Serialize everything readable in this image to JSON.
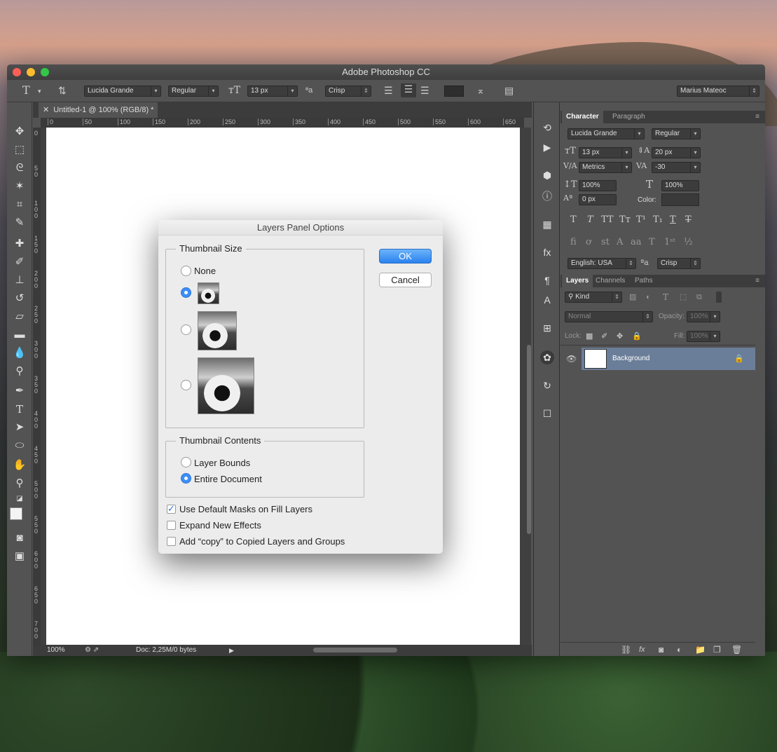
{
  "app": {
    "title": "Adobe Photoshop CC",
    "user": "Marius Mateoc"
  },
  "options_bar": {
    "font_family": "Lucida Grande",
    "font_style": "Regular",
    "font_size": "13 px",
    "antialias": "Crisp"
  },
  "document": {
    "tab_title": "Untitled-1 @ 100% (RGB/8) *",
    "zoom": "100%",
    "doc_info": "Doc: 2,25M/0 bytes",
    "ruler_h": [
      "0",
      "50",
      "100",
      "150",
      "200",
      "250",
      "300",
      "350",
      "400",
      "450",
      "500",
      "550",
      "600",
      "650"
    ],
    "ruler_v": [
      "0",
      "50",
      "100",
      "150",
      "200",
      "250",
      "300",
      "350",
      "400",
      "450",
      "500",
      "550",
      "600",
      "650",
      "700"
    ]
  },
  "character_panel": {
    "tabs": [
      "Character",
      "Paragraph"
    ],
    "font_family": "Lucida Grande",
    "font_style": "Regular",
    "size": "13 px",
    "leading": "20 px",
    "kerning": "Metrics",
    "tracking": "-30",
    "vscale": "100%",
    "hscale": "100%",
    "baseline": "0 px",
    "color_label": "Color:",
    "language": "English: USA",
    "antialias": "Crisp"
  },
  "layers_panel": {
    "tabs": [
      "Layers",
      "Channels",
      "Paths"
    ],
    "filter": "Kind",
    "blend_mode": "Normal",
    "opacity_label": "Opacity:",
    "opacity": "100%",
    "lock_label": "Lock:",
    "fill_label": "Fill:",
    "fill": "100%",
    "layers": [
      {
        "name": "Background"
      }
    ]
  },
  "dialog": {
    "title": "Layers Panel Options",
    "thumbnail_size": {
      "title": "Thumbnail Size",
      "none_label": "None",
      "selected": "small"
    },
    "thumbnail_contents": {
      "title": "Thumbnail Contents",
      "layer_bounds": "Layer Bounds",
      "entire_document": "Entire Document",
      "selected": "entire_document"
    },
    "options": [
      {
        "label": "Use Default Masks on Fill Layers",
        "checked": true
      },
      {
        "label": "Expand New Effects",
        "checked": false
      },
      {
        "label": "Add “copy” to Copied Layers and Groups",
        "checked": false
      }
    ],
    "ok_label": "OK",
    "cancel_label": "Cancel"
  },
  "colors": {
    "accent": "#3d8ef7",
    "panel_bg": "#535353",
    "layer_selected": "#6b7e99"
  }
}
